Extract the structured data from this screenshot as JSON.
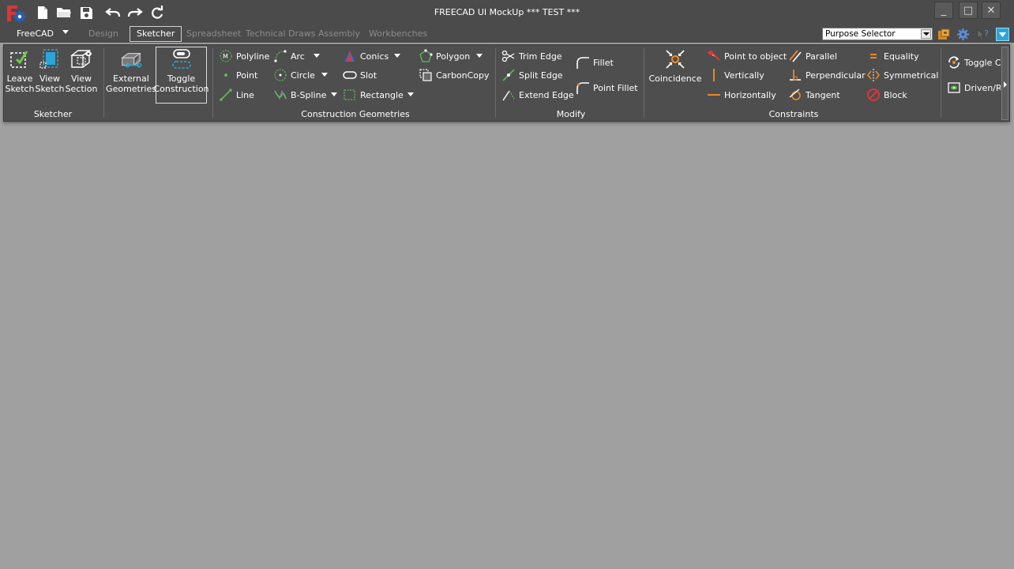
{
  "window": {
    "title": "FREECAD UI MockUp *** TEST ***",
    "minimize_glyph": "_",
    "maximize_glyph": "□",
    "close_glyph": "✕"
  },
  "quick_access": [
    "new-file-icon",
    "open-folder-icon",
    "save-icon",
    "undo-icon",
    "redo-icon",
    "refresh-icon"
  ],
  "tabs": {
    "app": "FreeCAD",
    "items": [
      "Design",
      "Sketcher",
      "Spreadsheet",
      "Technical Draws",
      "Assembly",
      "Workbenches"
    ],
    "active": "Sketcher"
  },
  "purpose_selector": {
    "value": "Purpose Selector"
  },
  "ribbon": {
    "sketcher": {
      "label": "Sketcher",
      "buttons": [
        "Leave\nSketch",
        "View\nSketch",
        "View\nSection"
      ]
    },
    "geometries": {
      "external": "External\nGeometries",
      "toggle": "Toggle\nConstruction"
    },
    "construction": {
      "label": "Construction Geometries",
      "col1": [
        "Polyline",
        "Point",
        "Line"
      ],
      "col2": [
        "Arc",
        "Circle",
        "B-Spline"
      ],
      "col3": [
        "Conics",
        "Slot",
        "Rectangle"
      ],
      "col4": [
        "Polygon",
        "CarbonCopy"
      ]
    },
    "modify": {
      "label": "Modify",
      "col1": [
        "Trim Edge",
        "Split Edge",
        "Extend Edge"
      ],
      "col2": [
        "Fillet",
        "Point Fillet"
      ]
    },
    "constraints": {
      "label": "Constraints",
      "big": "Coincidence",
      "col1": [
        "Point to object",
        "Vertically",
        "Horizontally"
      ],
      "col2": [
        "Parallel",
        "Perpendicular",
        "Tangent"
      ],
      "col3": [
        "Equality",
        "Symmetrical",
        "Block"
      ]
    },
    "extra": [
      "Toggle Cons",
      "Driven/Refer"
    ]
  },
  "colors": {
    "background": "#a0a0a0",
    "ribbon": "#4e4e4e",
    "titlebar": "#4b4b4b",
    "accent_orange": "#e8882a",
    "accent_blue": "#2aa6d8",
    "accent_green": "#5fb85a",
    "accent_red": "#d8383a"
  }
}
